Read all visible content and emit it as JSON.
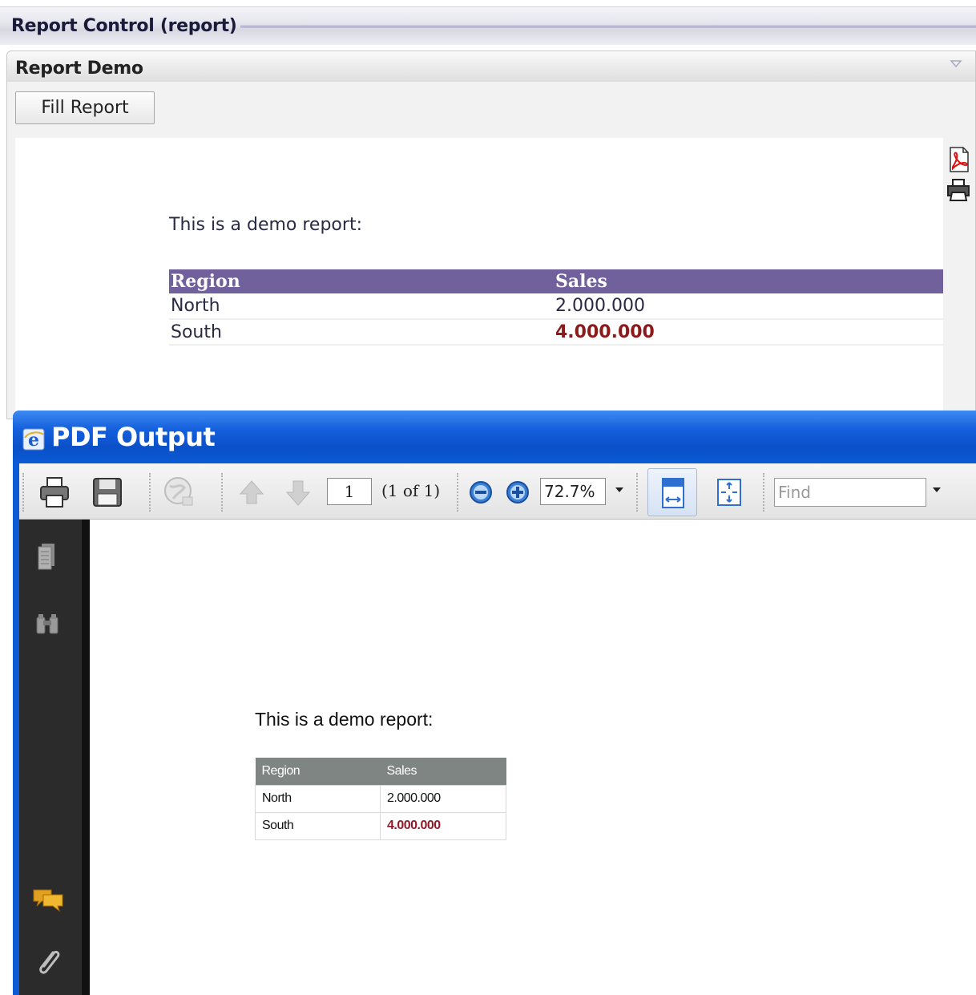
{
  "header": {
    "title": "Report Control (report)"
  },
  "demo_panel": {
    "title": "Report Demo",
    "fill_button_label": "Fill Report",
    "side_icons": [
      "pdf-icon",
      "print-icon"
    ]
  },
  "report": {
    "intro": "This is a demo report:",
    "columns": [
      "Region",
      "Sales"
    ],
    "rows": [
      {
        "region": "North",
        "sales": "2.000.000",
        "highlight": false
      },
      {
        "region": "South",
        "sales": "4.000.000",
        "highlight": true
      }
    ],
    "highlight_color": "#8c1a1a",
    "header_color": "#70609c"
  },
  "pdf_window": {
    "title": "PDF Output",
    "toolbar": {
      "page_number": "1",
      "page_count": "(1 of 1)",
      "zoom": "72.7%",
      "find_placeholder": "Find",
      "icons": [
        "print-icon",
        "save-icon",
        "web-icon",
        "previous-page-icon",
        "next-page-icon",
        "zoom-out-icon",
        "zoom-in-icon",
        "fit-width-icon",
        "fit-page-icon"
      ]
    },
    "sidebar_icons": [
      "pages-icon",
      "binoculars-icon",
      "comments-icon",
      "attachments-icon"
    ],
    "document": {
      "intro": "This is a demo report:",
      "columns": [
        "Region",
        "Sales"
      ],
      "rows": [
        {
          "region": "North",
          "sales": "2.000.000",
          "highlight": false
        },
        {
          "region": "South",
          "sales": "4.000.000",
          "highlight": true
        }
      ],
      "header_color": "#7f8582"
    }
  }
}
